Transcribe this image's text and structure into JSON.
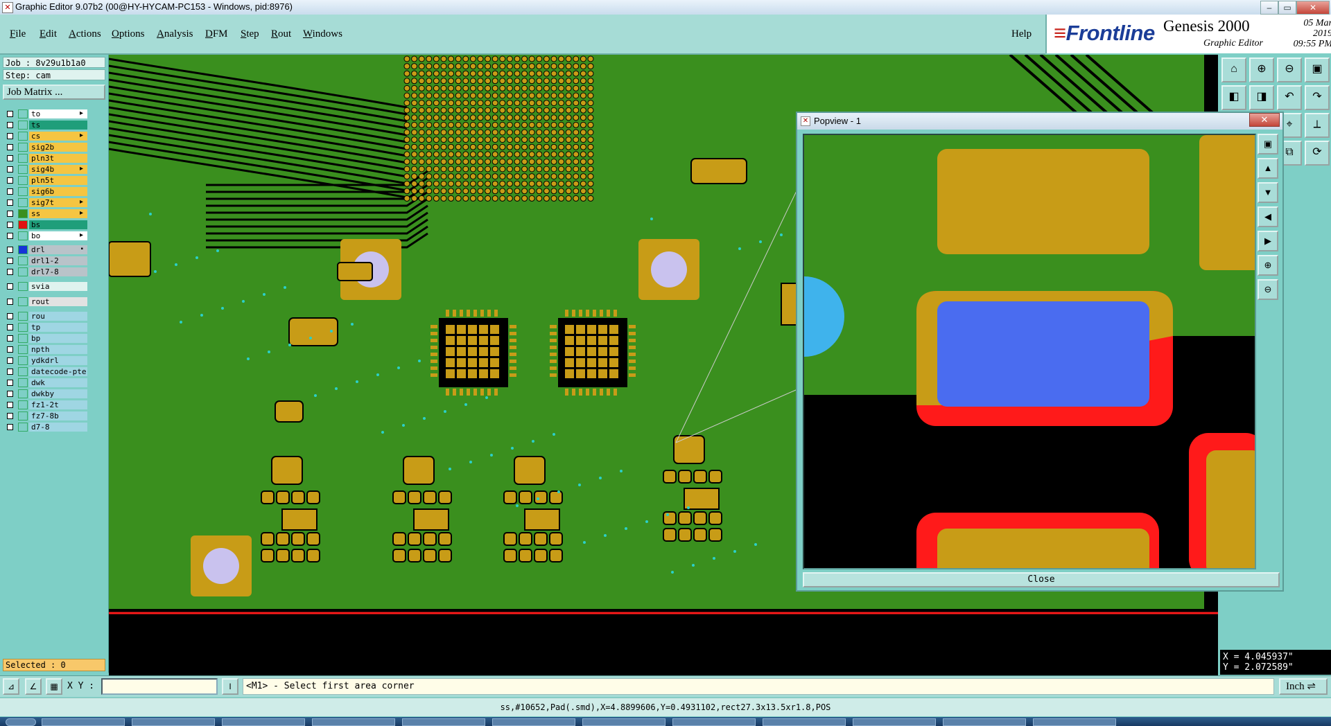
{
  "window": {
    "title": "Graphic Editor 9.07b2 (00@HY-HYCAM-PC153 - Windows, pid:8976)",
    "minimize_icon": "minimize-icon",
    "restore_icon": "restore-icon",
    "close_symbol": "✕"
  },
  "menu": [
    "File",
    "Edit",
    "Actions",
    "Options",
    "Analysis",
    "DFM",
    "Step",
    "Rout",
    "Windows"
  ],
  "help_label": "Help",
  "brand": {
    "logo": "Frontline",
    "product": "Genesis 2000",
    "subtitle": "Graphic Editor",
    "date": "05 Mar 2019",
    "time": "09:55 PM"
  },
  "job": {
    "job_line": "Job : 8v29u1b1a0",
    "step_line": "Step: cam",
    "matrix_button": "Job Matrix ..."
  },
  "layers": [
    {
      "name": "to",
      "color": "#ffffff",
      "mark": "▸"
    },
    {
      "name": "ts",
      "color": "#1f9e7a",
      "mark": ""
    },
    {
      "name": "cs",
      "color": "#f5c542",
      "mark": "▸"
    },
    {
      "name": "sig2b",
      "color": "#f5c542",
      "mark": ""
    },
    {
      "name": "pln3t",
      "color": "#f5c542",
      "mark": ""
    },
    {
      "name": "sig4b",
      "color": "#f5c542",
      "mark": "▸"
    },
    {
      "name": "pln5t",
      "color": "#f5c542",
      "mark": ""
    },
    {
      "name": "sig6b",
      "color": "#f5c542",
      "mark": ""
    },
    {
      "name": "sig7t",
      "color": "#f5c542",
      "mark": "▸"
    },
    {
      "name": "ss",
      "color": "#f5c542",
      "mark": "▸"
    },
    {
      "name": "bs",
      "color": "#1f9e7a",
      "mark": ""
    },
    {
      "name": "bo",
      "color": "#ffffff",
      "mark": "▸"
    },
    {
      "name": "drl",
      "color": "#b9c3c9",
      "mark": "▪"
    },
    {
      "name": "drl1-2",
      "color": "#b9c3c9",
      "mark": ""
    },
    {
      "name": "drl7-8",
      "color": "#b9c3c9",
      "mark": ""
    },
    {
      "name": "svia",
      "color": "#dff3ef",
      "mark": ""
    },
    {
      "name": "rout",
      "color": "#e2e2e2",
      "mark": ""
    },
    {
      "name": "rou",
      "color": "#9fd6e3",
      "mark": ""
    },
    {
      "name": "tp",
      "color": "#9fd6e3",
      "mark": ""
    },
    {
      "name": "bp",
      "color": "#9fd6e3",
      "mark": ""
    },
    {
      "name": "npth",
      "color": "#9fd6e3",
      "mark": ""
    },
    {
      "name": "ydkdrl",
      "color": "#9fd6e3",
      "mark": ""
    },
    {
      "name": "datecode-pte",
      "color": "#9fd6e3",
      "mark": ""
    },
    {
      "name": "dwk",
      "color": "#9fd6e3",
      "mark": ""
    },
    {
      "name": "dwkby",
      "color": "#9fd6e3",
      "mark": ""
    },
    {
      "name": "fz1-2t",
      "color": "#9fd6e3",
      "mark": ""
    },
    {
      "name": "fz7-8b",
      "color": "#9fd6e3",
      "mark": ""
    },
    {
      "name": "d7-8",
      "color": "#9fd6e3",
      "mark": ""
    }
  ],
  "selected": "Selected : 0",
  "popview": {
    "title": "Popview - 1",
    "close_label": "Close",
    "close_symbol": "✕"
  },
  "command": {
    "xy_label": "X Y :",
    "xy_value": "",
    "prompt": "<M1> - Select first area corner",
    "units": "Inch"
  },
  "coords": {
    "x": "X = 4.045937\"",
    "y": "Y = 2.072589\""
  },
  "status": "ss,#10652,Pad(.smd),X=4.8899606,Y=0.4931102,rect27.3x13.5xr1.8,POS",
  "colors": {
    "board_green": "#3a8f1e",
    "copper_gold": "#c89c17",
    "trace_dark": "#000000",
    "via_lavender": "#c9c2ee",
    "pad_blue": "#4a6cf0",
    "mask_red": "#ff1a1a",
    "hole_cyan": "#3fb3ec"
  },
  "icons": {
    "layer_checkbox": "checkbox-icon",
    "tool_buttons": [
      "zoom-home-icon",
      "zoom-in-icon",
      "zoom-out-icon",
      "zoom-fit-icon",
      "pan-left-icon",
      "pan-right-icon",
      "undo-icon",
      "redo-icon",
      "layers-icon",
      "help-icon",
      "snap-icon",
      "measure-icon",
      "select-icon",
      "move-icon",
      "copy-icon",
      "rotate-icon",
      "ruler-icon",
      "arrow-icon"
    ]
  }
}
